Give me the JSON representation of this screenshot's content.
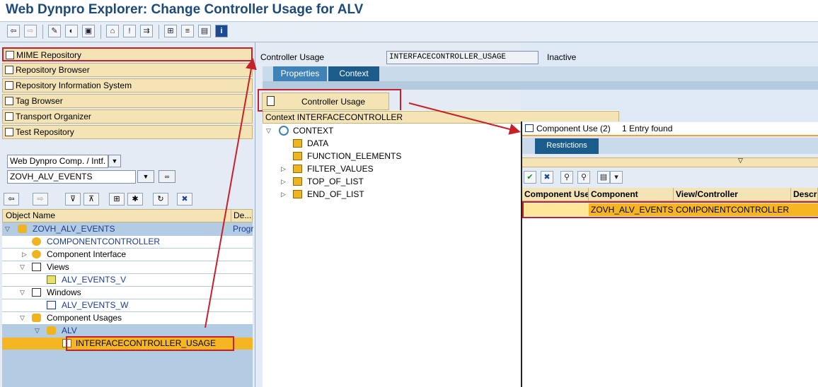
{
  "window": {
    "title": "Web Dynpro Explorer: Change Controller Usage for ALV"
  },
  "toolbar": {
    "buttons": [
      "back-icon",
      "forward-icon",
      "display-change-icon",
      "active-inactive-icon",
      "other-object-icon",
      "where-used-icon",
      "check-icon",
      "activate-icon",
      "navigate-icon",
      "hierarchy-icon",
      "print-icon",
      "display-object-list-icon",
      "info-icon"
    ]
  },
  "left_nav": {
    "items": [
      {
        "label": "MIME Repository",
        "icon": "mime-icon"
      },
      {
        "label": "Repository Browser",
        "icon": "repository-browser-icon"
      },
      {
        "label": "Repository Information System",
        "icon": "info-system-icon"
      },
      {
        "label": "Tag Browser",
        "icon": "tag-browser-icon"
      },
      {
        "label": "Transport Organizer",
        "icon": "transport-icon"
      },
      {
        "label": "Test Repository",
        "icon": "test-repository-icon"
      }
    ],
    "object_type_select": "Web Dynpro Comp. / Intf.",
    "object_name_input": "ZOVH_ALV_EVENTS"
  },
  "tree": {
    "col_object_name": "Object Name",
    "col_desc": "De...",
    "rows": [
      {
        "label": "ZOVH_ALV_EVENTS",
        "desc": "Progr",
        "link": true
      },
      {
        "label": "COMPONENTCONTROLLER",
        "link": true
      },
      {
        "label": "Component Interface",
        "link": false
      },
      {
        "label": "Views",
        "link": false
      },
      {
        "label": "ALV_EVENTS_V",
        "link": true
      },
      {
        "label": "Windows",
        "link": false
      },
      {
        "label": "ALV_EVENTS_W",
        "link": true
      },
      {
        "label": "Component Usages",
        "link": false
      },
      {
        "label": "ALV",
        "link": true
      },
      {
        "label": "INTERFACECONTROLLER_USAGE",
        "link": true
      }
    ]
  },
  "controller": {
    "label": "Controller Usage",
    "value": "INTERFACECONTROLLER_USAGE",
    "status": "Inactive",
    "tabs": [
      "Properties",
      "Context"
    ],
    "usage_button": "Controller Usage",
    "context_header": "Context INTERFACECONTROLLER",
    "context_nodes": [
      "CONTEXT",
      "DATA",
      "FUNCTION_ELEMENTS",
      "FILTER_VALUES",
      "TOP_OF_LIST",
      "END_OF_LIST"
    ]
  },
  "popup": {
    "title": "Component Use (2)",
    "entries": "1 Entry found",
    "tab": "Restrictions",
    "columns": [
      "Component Use",
      "Component",
      "View/Controller",
      "Descri"
    ],
    "rows": [
      {
        "component_use": "",
        "component": "ZOVH_ALV_EVENTS",
        "view_controller": "COMPONENTCONTROLLER",
        "descr": ""
      }
    ]
  },
  "colors": {
    "title": "#1d4a7a",
    "highlight_row": "#f6b624",
    "annotation_red": "#c8202a",
    "tab_active": "#1b5c8a"
  }
}
